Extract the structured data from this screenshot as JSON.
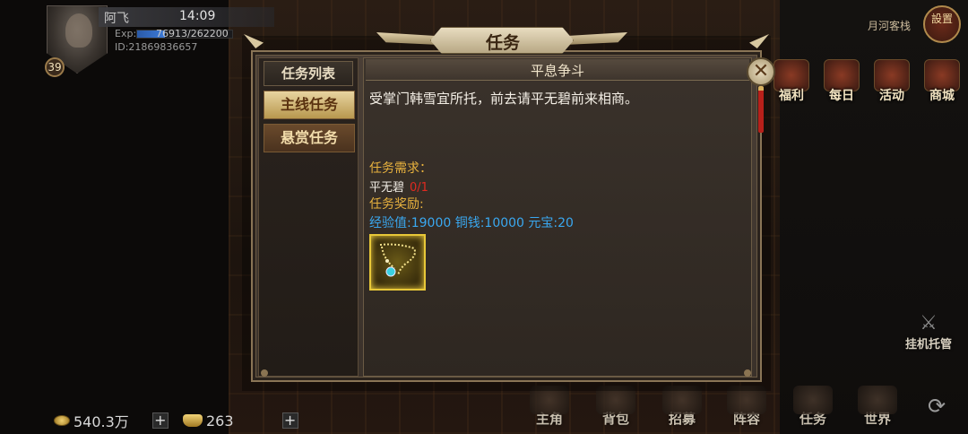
{
  "player": {
    "name": "阿飞",
    "time": "14:09",
    "exp_label": "Exp:",
    "exp_text": "76913/262200",
    "exp_fraction": 0.293,
    "id_text": "ID:21869836657",
    "level": "39"
  },
  "top_right": {
    "location": "月河客栈",
    "settings_label": "設置"
  },
  "activities": [
    {
      "label": "福利",
      "icon": "welfare-icon"
    },
    {
      "label": "每日",
      "icon": "daily-icon"
    },
    {
      "label": "活动",
      "icon": "event-icon"
    },
    {
      "label": "商城",
      "icon": "shop-icon"
    }
  ],
  "hangup": {
    "label": "挂机托管",
    "icon": "crossed-swords-icon"
  },
  "currency": {
    "silver": "540.3万",
    "gold": "263"
  },
  "bottom_nav": [
    {
      "label": "主角"
    },
    {
      "label": "背包"
    },
    {
      "label": "招募"
    },
    {
      "label": "阵容"
    },
    {
      "label": "任务"
    },
    {
      "label": "世界"
    }
  ],
  "dialog": {
    "title": "任务",
    "close_symbol": "✕",
    "list_header": "任务列表",
    "tabs": [
      {
        "label": "主线任务",
        "selected": true
      },
      {
        "label": "悬赏任务",
        "selected": false
      }
    ],
    "quest": {
      "name": "平息争斗",
      "description": "受掌门韩雪宜所托，前去请平无碧前来相商。",
      "requirement_label": "任务需求：",
      "requirement_target": "平无碧",
      "requirement_count": "0/1",
      "reward_label": "任务奖励:",
      "reward_line": "经验值:19000 铜钱:10000 元宝:20",
      "reward_item_icon": "jade-necklace-icon"
    }
  },
  "colors": {
    "accent_gold": "#e8b23e",
    "reward_blue": "#3aa8f0",
    "count_red": "#e02a20"
  }
}
